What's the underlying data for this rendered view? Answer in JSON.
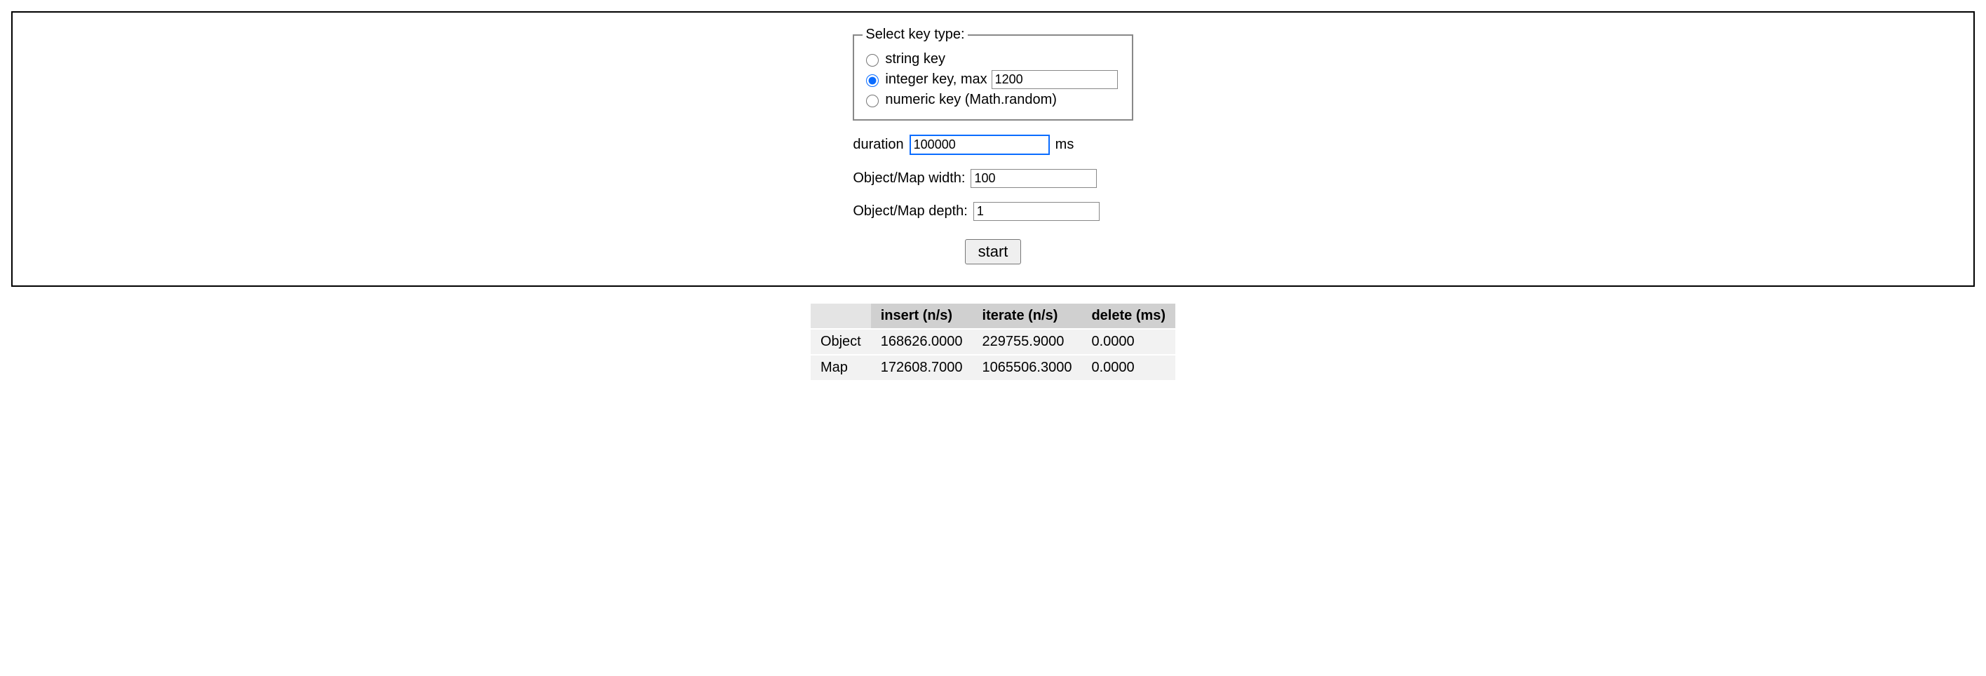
{
  "fieldset": {
    "legend": "Select key type:",
    "options": {
      "string_label": "string key",
      "integer_label": "integer key, max",
      "integer_max_value": "1200",
      "numeric_label": "numeric key (Math.random)"
    }
  },
  "duration": {
    "label": "duration",
    "value": "100000",
    "unit": "ms"
  },
  "width": {
    "label": "Object/Map width:",
    "value": "100"
  },
  "depth": {
    "label": "Object/Map depth:",
    "value": "1"
  },
  "start_label": "start",
  "results": {
    "headers": {
      "insert": "insert (n/s)",
      "iterate": "iterate (n/s)",
      "delete": "delete (ms)"
    },
    "rows": [
      {
        "label": "Object",
        "insert": "168626.0000",
        "iterate": "229755.9000",
        "delete": "0.0000"
      },
      {
        "label": "Map",
        "insert": "172608.7000",
        "iterate": "1065506.3000",
        "delete": "0.0000"
      }
    ]
  }
}
